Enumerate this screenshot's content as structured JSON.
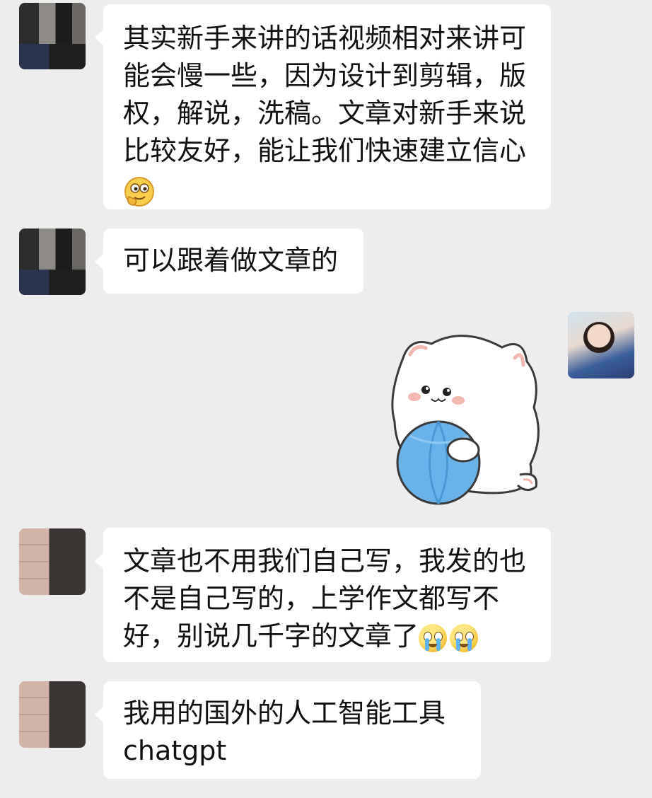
{
  "messages": [
    {
      "side": "left",
      "text": "其实新手来讲的话视频相对来讲可能会慢一些，因为设计到剪辑，版权，解说，洗稿。文章对新手来说比较友好，能让我们快速建立信心",
      "emoji": [
        "smirk-emoji"
      ]
    },
    {
      "side": "left",
      "text": "可以跟着做文章的"
    },
    {
      "side": "right",
      "type": "sticker",
      "sticker": "white-cat-holding-blue-ball"
    },
    {
      "side": "left",
      "text": "文章也不用我们自己写，我发的也不是自己写的，上学作文都写不好，别说几千字的文章了",
      "emoji": [
        "crying-emoji",
        "crying-emoji"
      ]
    },
    {
      "side": "left",
      "text": "我用的国外的人工智能工具chatgpt"
    }
  ],
  "colors": {
    "background": "#ededed",
    "bubble": "#ffffff",
    "text": "#111111",
    "ball": "#69b3ea"
  },
  "icons": {
    "smirk": "smirk-emoji",
    "cry": "crying-emoji"
  }
}
